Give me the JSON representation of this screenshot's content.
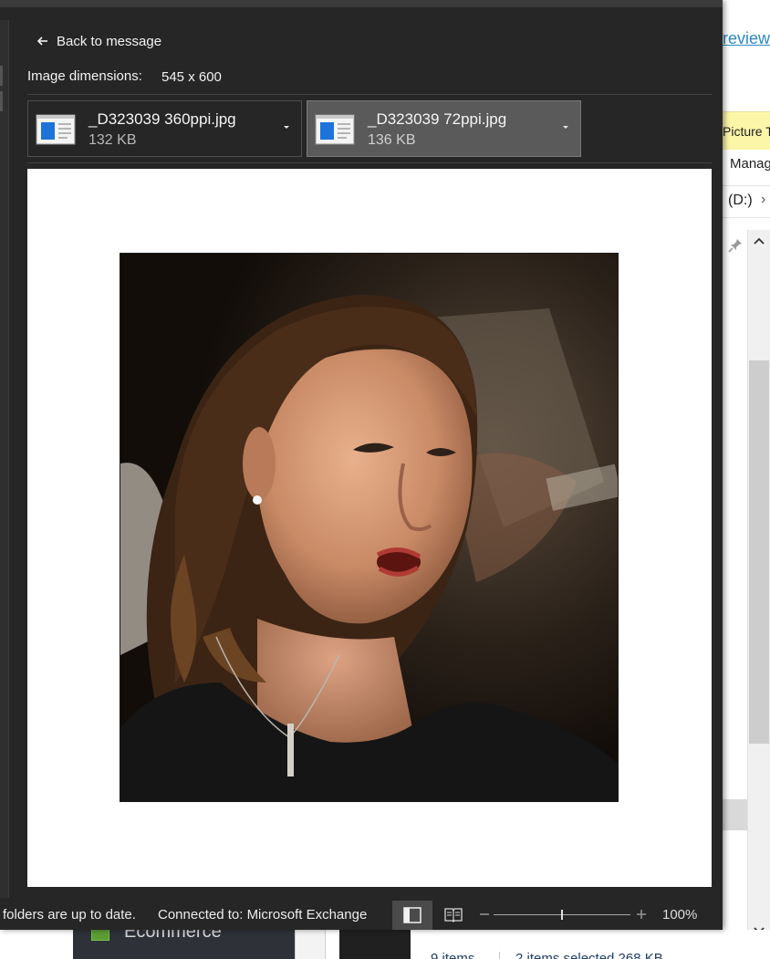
{
  "viewer": {
    "back_label": "Back to message",
    "dimensions_label": "Image dimensions:",
    "dimensions_value": "545 x 600",
    "attachments": [
      {
        "name": "_D323039 360ppi.jpg",
        "size": "132 KB",
        "icon": "image-file-icon",
        "selected": false
      },
      {
        "name": "_D323039 72ppi.jpg",
        "size": "136 KB",
        "icon": "image-file-icon",
        "selected": true
      }
    ],
    "preview_image": "photo-woman-singing"
  },
  "status_bar": {
    "sync_text": "folders are up to date.",
    "connection_text": "Connected to: Microsoft Exchange",
    "zoom_level": "100%",
    "zoom_fraction": 0.5
  },
  "background_window": {
    "link_text": "review",
    "band_text": "Picture T",
    "manage_text": "Manag",
    "drive_text": "(D:)",
    "items_text": "9 items",
    "selected_text": "2 items selected  268 KB",
    "ecommerce_text": "Ecommerce"
  },
  "colors": {
    "window_bg": "#262626",
    "selected_attachment": "#5a5a5a",
    "link": "#2b8ac6",
    "band": "#fcf6a8"
  }
}
